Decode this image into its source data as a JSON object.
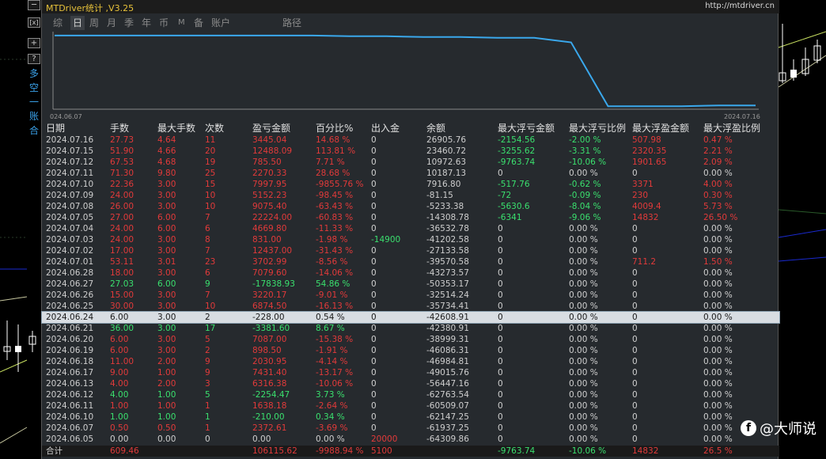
{
  "app": {
    "title": "MTDriver统计 ,V3.25",
    "url": "http://mtdriver.cn"
  },
  "toolbar": {
    "btn_minus": "─",
    "btn_x": "[x]",
    "btn_plus": "+",
    "btn_q": "?",
    "chars": [
      "多",
      "空",
      "一",
      "账",
      "合"
    ]
  },
  "tabs": [
    "综",
    "日",
    "周",
    "月",
    "季",
    "年",
    "币",
    "M",
    "备",
    "账户",
    "路径"
  ],
  "chart": {
    "x_start": "024.06.07",
    "x_end": "2024.07.16",
    "line": [
      0.03,
      0.03,
      0.03,
      0.03,
      0.03,
      0.03,
      0.03,
      0.03,
      0.04,
      0.04,
      0.05,
      0.05,
      0.06,
      0.06,
      0.12,
      0.96,
      0.96,
      0.96,
      0.95,
      0.95
    ]
  },
  "columns": [
    "日期",
    "手数",
    "最大手数",
    "次数",
    "盈亏金额",
    "百分比%",
    "出入金",
    "余额",
    "最大浮亏金额",
    "最大浮亏比例",
    "最大浮盈金额",
    "最大浮盈比例"
  ],
  "rows": [
    [
      "2024.07.16",
      "27.73",
      "4.64",
      "11",
      "3445.04",
      "14.68 %",
      "0",
      "26905.76",
      "-2154.56",
      "-2.00 %",
      "507.98",
      "0.47 %"
    ],
    [
      "2024.07.15",
      "51.90",
      "4.66",
      "20",
      "12488.09",
      "113.81 %",
      "0",
      "23460.72",
      "-3255.62",
      "-3.31 %",
      "2320.35",
      "2.21 %"
    ],
    [
      "2024.07.12",
      "67.53",
      "4.68",
      "19",
      "785.50",
      "7.71 %",
      "0",
      "10972.63",
      "-9763.74",
      "-10.06 %",
      "1901.65",
      "2.09 %"
    ],
    [
      "2024.07.11",
      "71.30",
      "9.80",
      "25",
      "2270.33",
      "28.68 %",
      "0",
      "10187.13",
      "0",
      "0.00 %",
      "0",
      "0.00 %"
    ],
    [
      "2024.07.10",
      "22.36",
      "3.00",
      "15",
      "7997.95",
      "-9855.76 %",
      "0",
      "7916.80",
      "-517.76",
      "-0.62 %",
      "3371",
      "4.00 %"
    ],
    [
      "2024.07.09",
      "24.00",
      "3.00",
      "10",
      "5152.23",
      "-98.45 %",
      "0",
      "-81.15",
      "-72",
      "-0.09 %",
      "230",
      "0.30 %"
    ],
    [
      "2024.07.08",
      "26.00",
      "3.00",
      "10",
      "9075.40",
      "-63.43 %",
      "0",
      "-5233.38",
      "-5630.6",
      "-8.04 %",
      "4009.4",
      "5.73 %"
    ],
    [
      "2024.07.05",
      "27.00",
      "6.00",
      "7",
      "22224.00",
      "-60.83 %",
      "0",
      "-14308.78",
      "-6341",
      "-9.06 %",
      "14832",
      "26.50 %"
    ],
    [
      "2024.07.04",
      "24.00",
      "6.00",
      "6",
      "4669.80",
      "-11.33 %",
      "0",
      "-36532.78",
      "0",
      "0.00 %",
      "0",
      "0.00 %"
    ],
    [
      "2024.07.03",
      "24.00",
      "3.00",
      "8",
      "831.00",
      "-1.98 %",
      "-14900",
      "-41202.58",
      "0",
      "0.00 %",
      "0",
      "0.00 %"
    ],
    [
      "2024.07.02",
      "17.00",
      "3.00",
      "7",
      "12437.00",
      "-31.43 %",
      "0",
      "-27133.58",
      "0",
      "0.00 %",
      "0",
      "0.00 %"
    ],
    [
      "2024.07.01",
      "53.11",
      "3.01",
      "23",
      "3702.99",
      "-8.56 %",
      "0",
      "-39570.58",
      "0",
      "0.00 %",
      "711.2",
      "1.50 %"
    ],
    [
      "2024.06.28",
      "18.00",
      "3.00",
      "6",
      "7079.60",
      "-14.06 %",
      "0",
      "-43273.57",
      "0",
      "0.00 %",
      "0",
      "0.00 %"
    ],
    [
      "2024.06.27",
      "27.03",
      "6.00",
      "9",
      "-17838.93",
      "54.86 %",
      "0",
      "-50353.17",
      "0",
      "0.00 %",
      "0",
      "0.00 %"
    ],
    [
      "2024.06.26",
      "15.00",
      "3.00",
      "7",
      "3220.17",
      "-9.01 %",
      "0",
      "-32514.24",
      "0",
      "0.00 %",
      "0",
      "0.00 %"
    ],
    [
      "2024.06.25",
      "30.00",
      "3.00",
      "10",
      "6874.50",
      "-16.13 %",
      "0",
      "-35734.41",
      "0",
      "0.00 %",
      "0",
      "0.00 %"
    ],
    [
      "2024.06.24",
      "6.00",
      "3.00",
      "2",
      "-228.00",
      "0.54 %",
      "0",
      "-42608.91",
      "0",
      "0.00 %",
      "0",
      "0.00 %"
    ],
    [
      "2024.06.21",
      "36.00",
      "3.00",
      "17",
      "-3381.60",
      "8.67 %",
      "0",
      "-42380.91",
      "0",
      "0.00 %",
      "0",
      "0.00 %"
    ],
    [
      "2024.06.20",
      "6.00",
      "3.00",
      "5",
      "7087.00",
      "-15.38 %",
      "0",
      "-38999.31",
      "0",
      "0.00 %",
      "0",
      "0.00 %"
    ],
    [
      "2024.06.19",
      "6.00",
      "3.00",
      "2",
      "898.50",
      "-1.91 %",
      "0",
      "-46086.31",
      "0",
      "0.00 %",
      "0",
      "0.00 %"
    ],
    [
      "2024.06.18",
      "11.00",
      "2.00",
      "9",
      "2030.95",
      "-4.14 %",
      "0",
      "-46984.81",
      "0",
      "0.00 %",
      "0",
      "0.00 %"
    ],
    [
      "2024.06.17",
      "9.00",
      "1.00",
      "9",
      "7431.40",
      "-13.17 %",
      "0",
      "-49015.76",
      "0",
      "0.00 %",
      "0",
      "0.00 %"
    ],
    [
      "2024.06.13",
      "4.00",
      "2.00",
      "3",
      "6316.38",
      "-10.06 %",
      "0",
      "-56447.16",
      "0",
      "0.00 %",
      "0",
      "0.00 %"
    ],
    [
      "2024.06.12",
      "4.00",
      "1.00",
      "5",
      "-2254.47",
      "3.73 %",
      "0",
      "-62763.54",
      "0",
      "0.00 %",
      "0",
      "0.00 %"
    ],
    [
      "2024.06.11",
      "1.00",
      "1.00",
      "1",
      "1638.18",
      "-2.64 %",
      "0",
      "-60509.07",
      "0",
      "0.00 %",
      "0",
      "0.00 %"
    ],
    [
      "2024.06.10",
      "1.00",
      "1.00",
      "1",
      "-210.00",
      "0.34 %",
      "0",
      "-62147.25",
      "0",
      "0.00 %",
      "0",
      "0.00 %"
    ],
    [
      "2024.06.07",
      "0.50",
      "0.50",
      "1",
      "2372.61",
      "-3.69 %",
      "0",
      "-61937.25",
      "0",
      "0.00 %",
      "0",
      "0.00 %"
    ],
    [
      "2024.06.05",
      "0.00",
      "0.00",
      "0",
      "0.00",
      "0.00 %",
      "20000",
      "-64309.86",
      "0",
      "0.00 %",
      "0",
      "0.00 %"
    ]
  ],
  "total": [
    "合计",
    "609.46",
    "",
    "",
    "106115.62",
    "-9988.94 %",
    "5100",
    "",
    "-9763.74",
    "-10.06 %",
    "14832",
    "26.5 %"
  ],
  "selected_row": 16,
  "watermark": {
    "logo": "f",
    "text": "@大师说"
  },
  "colors": {
    "red": "#e23a3a",
    "green": "#3ae06e",
    "white": "#cfcfcf",
    "title": "#e8c23a",
    "line": "#3aa8ec"
  }
}
